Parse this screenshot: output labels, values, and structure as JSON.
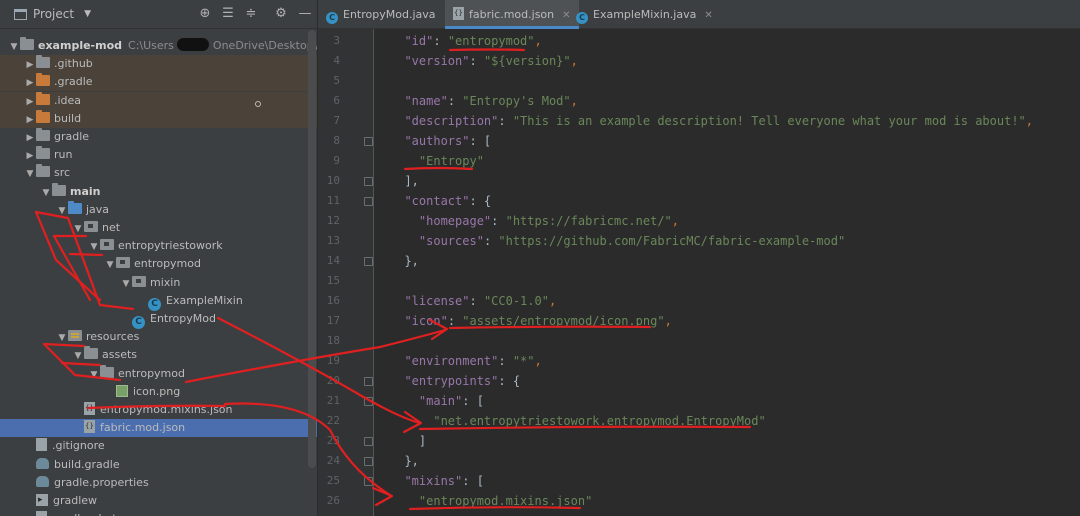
{
  "project_panel": {
    "title": "Project",
    "tree": [
      {
        "label": "example-mod",
        "path": "C:\\Users",
        "path2": "OneDrive\\Desktop\\Deskto",
        "depth": 0,
        "expanded": true,
        "icon": "folder-icon",
        "bold": true
      },
      {
        "label": ".github",
        "depth": 1,
        "expanded": false,
        "icon": "folder-icon",
        "excluded": true
      },
      {
        "label": ".gradle",
        "depth": 1,
        "expanded": false,
        "icon": "excluded-folder-icon",
        "excluded": true
      },
      {
        "label": ".idea",
        "depth": 1,
        "expanded": false,
        "icon": "excluded-folder-icon",
        "excluded": true
      },
      {
        "label": "build",
        "depth": 1,
        "expanded": false,
        "icon": "excluded-folder-icon",
        "excluded": true
      },
      {
        "label": "gradle",
        "depth": 1,
        "expanded": false,
        "icon": "folder-icon"
      },
      {
        "label": "run",
        "depth": 1,
        "expanded": false,
        "icon": "folder-icon"
      },
      {
        "label": "src",
        "depth": 1,
        "expanded": true,
        "icon": "folder-icon"
      },
      {
        "label": "main",
        "depth": 2,
        "expanded": true,
        "icon": "folder-icon",
        "bold": true
      },
      {
        "label": "java",
        "depth": 3,
        "expanded": true,
        "icon": "source-folder-icon"
      },
      {
        "label": "net",
        "depth": 4,
        "expanded": true,
        "icon": "package-icon"
      },
      {
        "label": "entropytriestowork",
        "depth": 5,
        "expanded": true,
        "icon": "package-icon"
      },
      {
        "label": "entropymod",
        "depth": 6,
        "expanded": true,
        "icon": "package-icon"
      },
      {
        "label": "mixin",
        "depth": 7,
        "expanded": true,
        "icon": "package-icon"
      },
      {
        "label": "ExampleMixin",
        "depth": 8,
        "icon": "class-icon"
      },
      {
        "label": "EntropyMod",
        "depth": 7,
        "icon": "class-icon"
      },
      {
        "label": "resources",
        "depth": 3,
        "expanded": true,
        "icon": "resources-folder-icon"
      },
      {
        "label": "assets",
        "depth": 4,
        "expanded": true,
        "icon": "folder-icon"
      },
      {
        "label": "entropymod",
        "depth": 5,
        "expanded": true,
        "icon": "folder-icon"
      },
      {
        "label": "icon.png",
        "depth": 6,
        "icon": "image-icon"
      },
      {
        "label": "entropymod.mixins.json",
        "depth": 4,
        "icon": "json-icon"
      },
      {
        "label": "fabric.mod.json",
        "depth": 4,
        "icon": "json-icon",
        "selected": true
      },
      {
        "label": ".gitignore",
        "depth": 1,
        "icon": "file-icon"
      },
      {
        "label": "build.gradle",
        "depth": 1,
        "icon": "gradle-icon"
      },
      {
        "label": "gradle.properties",
        "depth": 1,
        "icon": "gradle-icon"
      },
      {
        "label": "gradlew",
        "depth": 1,
        "icon": "terminal-icon"
      },
      {
        "label": "gradlew.bat",
        "depth": 1,
        "icon": "file-icon"
      }
    ]
  },
  "tabs": [
    {
      "label": "EntropyMod.java",
      "icon": "class-icon",
      "active": false
    },
    {
      "label": "fabric.mod.json",
      "icon": "json-icon",
      "active": true
    },
    {
      "label": "ExampleMixin.java",
      "icon": "class-icon",
      "active": false
    }
  ],
  "editor": {
    "lines": [
      {
        "n": "3",
        "tokens": [
          [
            "  ",
            ""
          ],
          [
            "\"id\"",
            "k"
          ],
          [
            ": ",
            ""
          ],
          [
            "\"entropymod\"",
            "s"
          ],
          [
            ",",
            "p"
          ]
        ]
      },
      {
        "n": "4",
        "tokens": [
          [
            "  ",
            ""
          ],
          [
            "\"version\"",
            "k"
          ],
          [
            ": ",
            ""
          ],
          [
            "\"${version}\"",
            "s"
          ],
          [
            ",",
            "p"
          ]
        ]
      },
      {
        "n": "5",
        "tokens": []
      },
      {
        "n": "6",
        "tokens": [
          [
            "  ",
            ""
          ],
          [
            "\"name\"",
            "k"
          ],
          [
            ": ",
            ""
          ],
          [
            "\"Entropy's Mod\"",
            "s"
          ],
          [
            ",",
            "p"
          ]
        ]
      },
      {
        "n": "7",
        "tokens": [
          [
            "  ",
            ""
          ],
          [
            "\"description\"",
            "k"
          ],
          [
            ": ",
            ""
          ],
          [
            "\"This is an example description! Tell everyone what your mod is about!\"",
            "s"
          ],
          [
            ",",
            "p"
          ]
        ]
      },
      {
        "n": "8",
        "tokens": [
          [
            "  ",
            ""
          ],
          [
            "\"authors\"",
            "k"
          ],
          [
            ": [",
            ""
          ]
        ],
        "fold": true
      },
      {
        "n": "9",
        "tokens": [
          [
            "    ",
            ""
          ],
          [
            "\"Entropy\"",
            "s"
          ]
        ]
      },
      {
        "n": "10",
        "tokens": [
          [
            "  ],",
            ""
          ]
        ],
        "fold": true
      },
      {
        "n": "11",
        "tokens": [
          [
            "  ",
            ""
          ],
          [
            "\"contact\"",
            "k"
          ],
          [
            ": {",
            ""
          ]
        ],
        "fold": true
      },
      {
        "n": "12",
        "tokens": [
          [
            "    ",
            ""
          ],
          [
            "\"homepage\"",
            "k"
          ],
          [
            ": ",
            ""
          ],
          [
            "\"https://fabricmc.net/\"",
            "s"
          ],
          [
            ",",
            "p"
          ]
        ]
      },
      {
        "n": "13",
        "tokens": [
          [
            "    ",
            ""
          ],
          [
            "\"sources\"",
            "k"
          ],
          [
            ": ",
            ""
          ],
          [
            "\"https://github.com/FabricMC/fabric-example-mod\"",
            "s"
          ]
        ]
      },
      {
        "n": "14",
        "tokens": [
          [
            "  },",
            ""
          ]
        ],
        "fold": true
      },
      {
        "n": "15",
        "tokens": []
      },
      {
        "n": "16",
        "tokens": [
          [
            "  ",
            ""
          ],
          [
            "\"license\"",
            "k"
          ],
          [
            ": ",
            ""
          ],
          [
            "\"CC0-1.0\"",
            "s"
          ],
          [
            ",",
            "p"
          ]
        ]
      },
      {
        "n": "17",
        "tokens": [
          [
            "  ",
            ""
          ],
          [
            "\"icon\"",
            "k"
          ],
          [
            ": ",
            ""
          ],
          [
            "\"assets/entropymod/icon.png\"",
            "s"
          ],
          [
            ",",
            "p"
          ]
        ]
      },
      {
        "n": "18",
        "tokens": []
      },
      {
        "n": "19",
        "tokens": [
          [
            "  ",
            ""
          ],
          [
            "\"environment\"",
            "k"
          ],
          [
            ": ",
            ""
          ],
          [
            "\"*\"",
            "s"
          ],
          [
            ",",
            "p"
          ]
        ]
      },
      {
        "n": "20",
        "tokens": [
          [
            "  ",
            ""
          ],
          [
            "\"entrypoints\"",
            "k"
          ],
          [
            ": {",
            ""
          ]
        ],
        "fold": true
      },
      {
        "n": "21",
        "tokens": [
          [
            "    ",
            ""
          ],
          [
            "\"main\"",
            "k"
          ],
          [
            ": [",
            ""
          ]
        ],
        "fold": true
      },
      {
        "n": "22",
        "tokens": [
          [
            "      ",
            ""
          ],
          [
            "\"net.entropytriestowork.entropymod.EntropyMod\"",
            "s"
          ]
        ]
      },
      {
        "n": "23",
        "tokens": [
          [
            "    ]",
            ""
          ]
        ],
        "fold": true
      },
      {
        "n": "24",
        "tokens": [
          [
            "  },",
            ""
          ]
        ],
        "fold": true
      },
      {
        "n": "25",
        "tokens": [
          [
            "  ",
            ""
          ],
          [
            "\"mixins\"",
            "k"
          ],
          [
            ": [",
            ""
          ]
        ],
        "fold": true
      },
      {
        "n": "26",
        "tokens": [
          [
            "    ",
            ""
          ],
          [
            "\"entropymod.mixins.json\"",
            "s"
          ]
        ]
      }
    ]
  },
  "colors": {
    "annotation": "#e02020",
    "selection": "#4b6eaf",
    "excluded_row": "#4b433a"
  }
}
